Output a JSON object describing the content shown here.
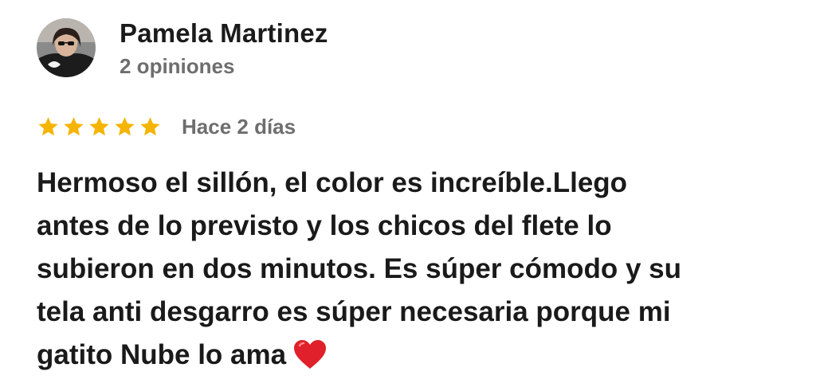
{
  "reviewer": {
    "name": "Pamela Martinez",
    "review_count": "2 opiniones",
    "avatar_icon": "profile-photo"
  },
  "rating": {
    "stars": 5,
    "max_stars": 5,
    "star_color": "#F5B400",
    "date": "Hace 2 días"
  },
  "review": {
    "lines": [
      "Hermoso el sillón, el color es increíble.Llego",
      "antes de lo previsto y los chicos del flete lo",
      "subieron en dos minutos. Es súper cómodo y su",
      "tela anti desgarro es súper necesaria porque mi",
      "gatito Nube lo ama"
    ],
    "emoji": "heart-icon",
    "emoji_color": "#E0202A"
  }
}
